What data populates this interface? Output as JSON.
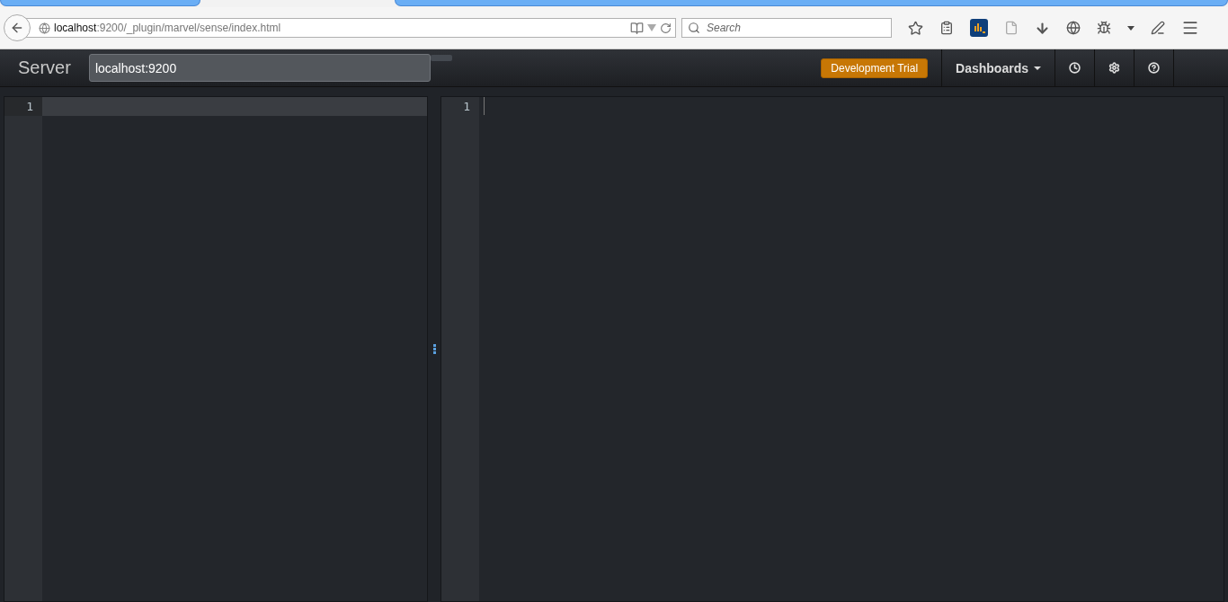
{
  "browser": {
    "url_host": "localhost",
    "url_path": ":9200/_plugin/marvel/sense/index.html",
    "search": {
      "placeholder": "Search"
    }
  },
  "navbar": {
    "brand": "Server",
    "server": {
      "value": "localhost:9200"
    },
    "trial": "Development Trial",
    "dashboards": "Dashboards"
  },
  "request_editor": {
    "line_numbers": [
      "1"
    ]
  },
  "response_editor": {
    "line_numbers": [
      "1"
    ]
  }
}
